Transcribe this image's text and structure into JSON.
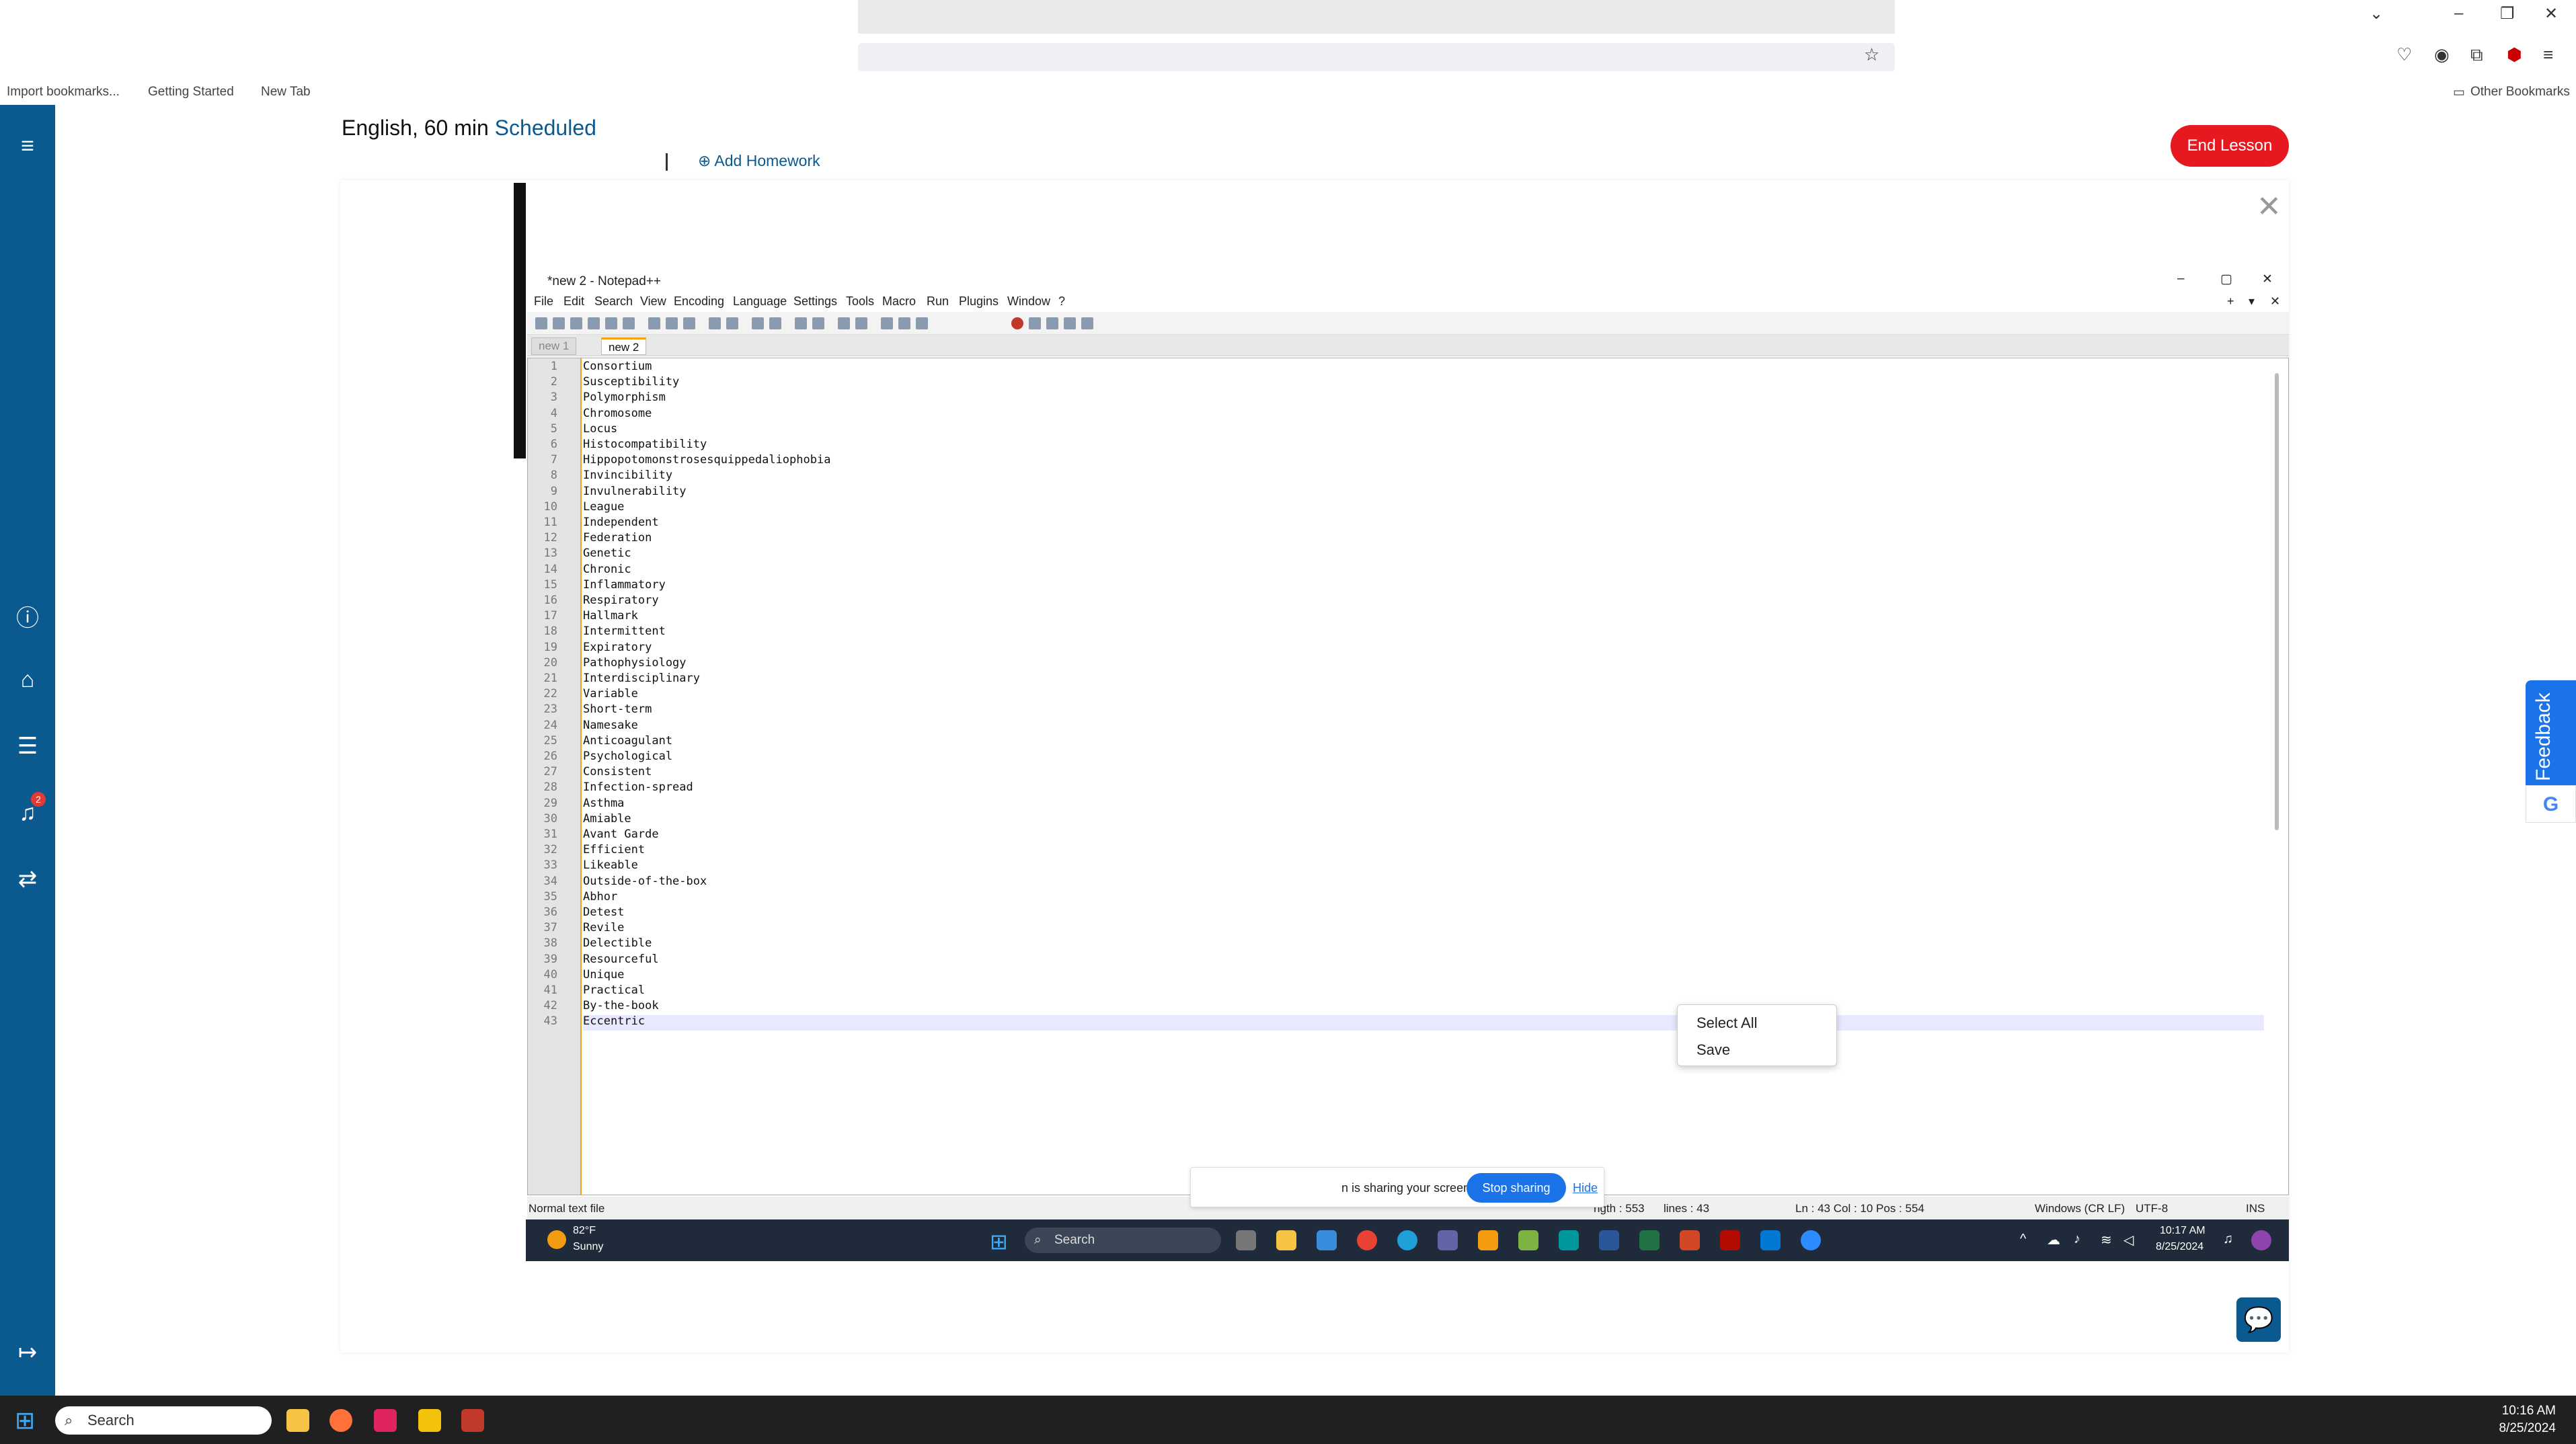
{
  "browser": {
    "bookmarks": [
      "Import bookmarks...",
      "Getting Started",
      "New Tab"
    ],
    "other_bookmarks": "Other Bookmarks"
  },
  "lesson": {
    "title": "English, 60 min",
    "status": "Scheduled",
    "add_homework": "Add Homework",
    "end_button": "End Lesson"
  },
  "sidebar": {
    "notification_count": "2"
  },
  "notepad": {
    "title": "*new 2 - Notepad++",
    "menu": [
      "File",
      "Edit",
      "Search",
      "View",
      "Encoding",
      "Language",
      "Settings",
      "Tools",
      "Macro",
      "Run",
      "Plugins",
      "Window",
      "?"
    ],
    "tabs": [
      "new 1",
      "new 2"
    ],
    "lines": [
      "Consortium",
      "Susceptibility",
      "Polymorphism",
      "Chromosome",
      "Locus",
      "Histocompatibility",
      "Hippopotomonstrosesquippedaliophobia",
      "Invincibility",
      "Invulnerability",
      "League",
      "Independent",
      "Federation",
      "Genetic",
      "Chronic",
      "Inflammatory",
      "Respiratory",
      "Hallmark",
      "Intermittent",
      "Expiratory",
      "Pathophysiology",
      "Interdisciplinary",
      "Variable",
      "Short-term",
      "Namesake",
      "Anticoagulant",
      "Psychological",
      "Consistent",
      "Infection-spread",
      "Asthma",
      "Amiable",
      "Avant Garde",
      "Efficient",
      "Likeable",
      "Outside-of-the-box",
      "Abhor",
      "Detest",
      "Revile",
      "Delectible",
      "Resourceful",
      "Unique",
      "Practical",
      "By-the-book",
      "Eccentric"
    ],
    "status": {
      "file_type": "Normal text file",
      "length": "ngth : 553",
      "lines": "lines : 43",
      "position": "Ln : 43    Col : 10    Pos : 554",
      "eol": "Windows (CR LF)",
      "encoding": "UTF-8",
      "mode": "INS"
    }
  },
  "context_menu": [
    "Select All",
    "Save"
  ],
  "share_bar": {
    "message": "n is sharing your screen.",
    "stop": "Stop sharing",
    "hide": "Hide"
  },
  "remote_taskbar": {
    "temp": "82°F",
    "weather": "Sunny",
    "search": "Search",
    "time": "10:17 AM",
    "date": "8/25/2024"
  },
  "feedback": "Feedback",
  "host_taskbar": {
    "search": "Search",
    "time": "10:16 AM",
    "date": "8/25/2024"
  }
}
